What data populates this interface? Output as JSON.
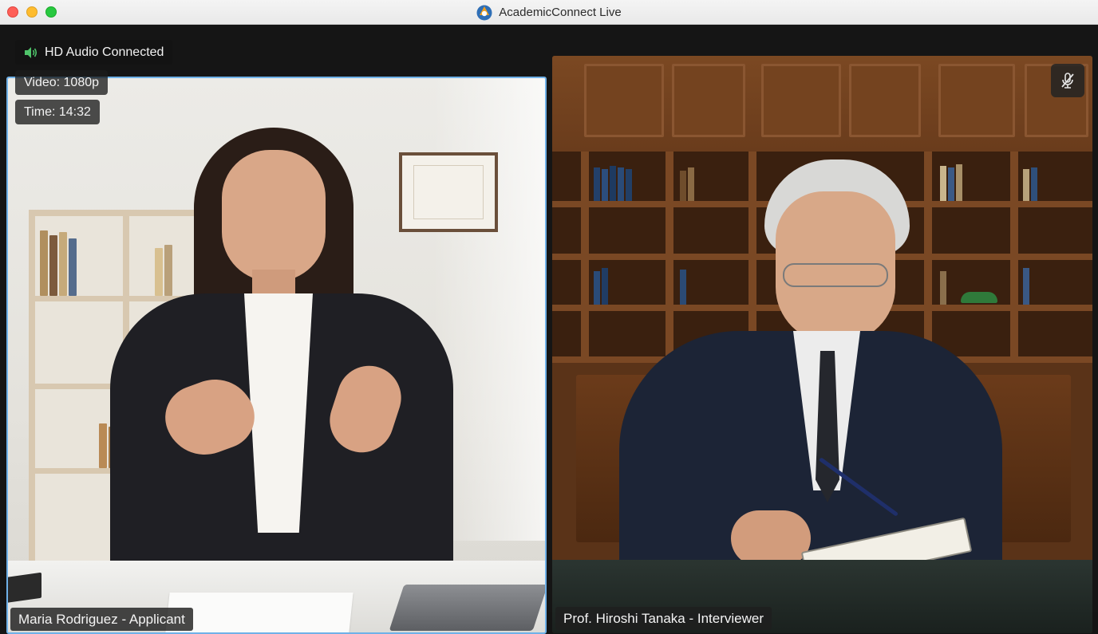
{
  "window": {
    "title": "AcademicConnect Live"
  },
  "status": {
    "audio": "HD Audio Connected",
    "video": "Video: 1080p",
    "time": "Time: 14:32"
  },
  "participants": [
    {
      "name": "Maria Rodriguez - Applicant",
      "active_speaker": true
    },
    {
      "name": "Prof. Hiroshi Tanaka - Interviewer",
      "muted": true
    }
  ],
  "icons": {
    "audio": "speaker-icon",
    "mute": "microphone-muted-icon",
    "app": "app-logo-icon"
  },
  "colors": {
    "active_speaker_border": "#6fb1e8",
    "audio_icon": "#4fc46a",
    "close": "#fe5f57",
    "minimize": "#febc2e",
    "maximize": "#28c840"
  }
}
